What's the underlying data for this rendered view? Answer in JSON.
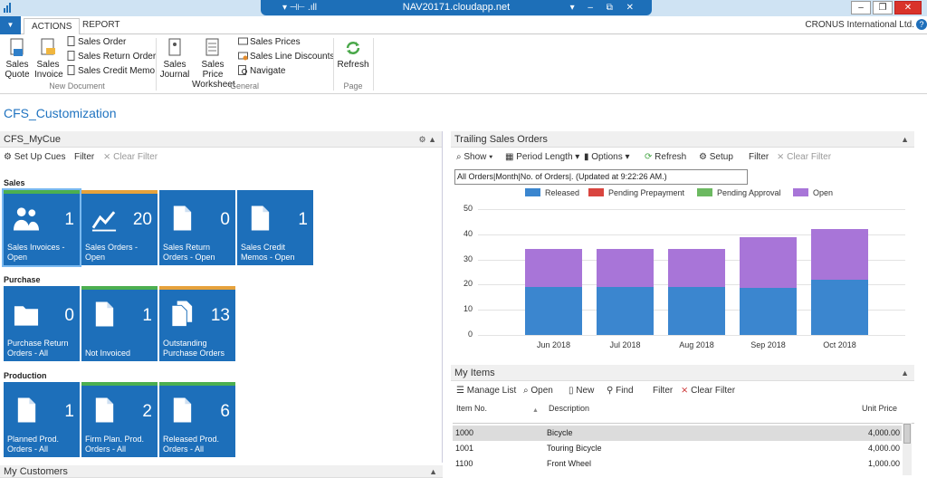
{
  "window": {
    "title": "NAV20171.cloudapp.net",
    "bar_left": "▾ ⊣⊢ .ıll",
    "bar_right": "▾ – ⧉ ✕"
  },
  "ribbon": {
    "tabs": [
      "ACTIONS",
      "REPORT"
    ],
    "company": "CRONUS International Ltd.",
    "groups": {
      "new_document": "New Document",
      "general": "General",
      "page": "Page"
    },
    "buttons": {
      "sales_quote": "Sales Quote",
      "sales_invoice": "Sales Invoice",
      "sales_order": "Sales Order",
      "sales_return_order": "Sales Return Order",
      "sales_credit_memo": "Sales Credit Memo",
      "sales_journal": "Sales Journal",
      "sales_price_worksheet": "Sales Price Worksheet",
      "sales_prices": "Sales Prices",
      "sales_line_discounts": "Sales Line Discounts",
      "navigate": "Navigate",
      "refresh": "Refresh"
    }
  },
  "page_title": "CFS_Customization",
  "cue": {
    "title": "CFS_MyCue",
    "tools": {
      "setup": "Set Up Cues",
      "filter": "Filter",
      "clear": "Clear Filter"
    },
    "sections": [
      "Sales",
      "Purchase",
      "Production"
    ],
    "tiles": [
      {
        "value": "1",
        "label": "Sales Invoices - Open",
        "icon": "people-icon"
      },
      {
        "value": "20",
        "label": "Sales Orders - Open",
        "icon": "trend-icon"
      },
      {
        "value": "0",
        "label": "Sales Return Orders - Open",
        "icon": "document-icon"
      },
      {
        "value": "1",
        "label": "Sales Credit Memos - Open",
        "icon": "document-icon"
      },
      {
        "value": "0",
        "label": "Purchase Return Orders - All",
        "icon": "folder-icon"
      },
      {
        "value": "1",
        "label": "Not Invoiced",
        "icon": "document-icon"
      },
      {
        "value": "13",
        "label": "Outstanding Purchase Orders",
        "icon": "documents-icon"
      },
      {
        "value": "1",
        "label": "Planned Prod. Orders - All",
        "icon": "document-icon"
      },
      {
        "value": "2",
        "label": "Firm Plan. Prod. Orders - All",
        "icon": "document-icon"
      },
      {
        "value": "6",
        "label": "Released Prod. Orders - All",
        "icon": "document-icon"
      }
    ],
    "colors": {
      "tile": "#1d6fba",
      "green": "#4caf50",
      "orange": "#e6a23c"
    }
  },
  "my_customers": {
    "title": "My Customers"
  },
  "trailing": {
    "title": "Trailing Sales Orders",
    "tools": {
      "show": "Show",
      "period": "Period Length",
      "options": "Options",
      "refresh": "Refresh",
      "setup": "Setup",
      "filter": "Filter",
      "clear": "Clear Filter"
    },
    "info": "All Orders|Month|No. of Orders|. (Updated at  9:22:26 AM.)"
  },
  "chart_data": {
    "type": "bar",
    "stacked": true,
    "categories": [
      "Jun 2018",
      "Jul 2018",
      "Aug 2018",
      "Sep 2018",
      "Oct 2018"
    ],
    "series": [
      {
        "name": "Released",
        "values": [
          19,
          19,
          19,
          19,
          22
        ],
        "color": "#3b86cf"
      },
      {
        "name": "Pending Prepayment",
        "values": [
          0,
          0,
          0,
          0,
          0
        ],
        "color": "#d9453f"
      },
      {
        "name": "Pending Approval",
        "values": [
          0,
          0,
          0,
          0,
          0
        ],
        "color": "#6cb961"
      },
      {
        "name": "Open",
        "values": [
          15,
          15,
          15,
          20,
          20
        ],
        "color": "#a875d8"
      }
    ],
    "yticks": [
      "0",
      "10",
      "20",
      "30",
      "40",
      "50"
    ],
    "ylim": [
      0,
      50
    ],
    "legend": "top"
  },
  "my_items": {
    "title": "My Items",
    "tools": {
      "manage": "Manage List",
      "open": "Open",
      "new": "New",
      "find": "Find",
      "filter": "Filter",
      "clear": "Clear Filter"
    },
    "columns": [
      "Item No.",
      "Description",
      "Unit Price"
    ],
    "rows": [
      {
        "no": "1000",
        "desc": "Bicycle",
        "price": "4,000.00"
      },
      {
        "no": "1001",
        "desc": "Touring Bicycle",
        "price": "4,000.00"
      },
      {
        "no": "1100",
        "desc": "Front Wheel",
        "price": "1,000.00"
      }
    ]
  }
}
